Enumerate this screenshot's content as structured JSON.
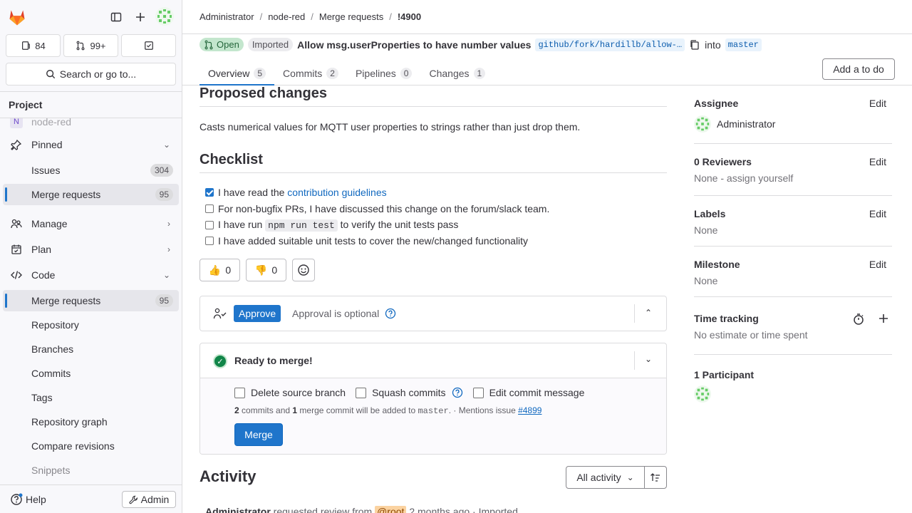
{
  "sidebar": {
    "counts": {
      "issues": "84",
      "merge_requests": "99+"
    },
    "search_label": "Search or go to...",
    "project_header": "Project",
    "project_name": "node-red",
    "pinned_label": "Pinned",
    "pinned_items": [
      {
        "label": "Issues",
        "count": "304"
      },
      {
        "label": "Merge requests",
        "count": "95"
      }
    ],
    "sections": [
      {
        "label": "Manage"
      },
      {
        "label": "Plan"
      },
      {
        "label": "Code"
      }
    ],
    "code_items": [
      {
        "label": "Merge requests",
        "count": "95"
      },
      {
        "label": "Repository"
      },
      {
        "label": "Branches"
      },
      {
        "label": "Commits"
      },
      {
        "label": "Tags"
      },
      {
        "label": "Repository graph"
      },
      {
        "label": "Compare revisions"
      },
      {
        "label": "Snippets"
      }
    ],
    "help_label": "Help",
    "admin_label": "Admin"
  },
  "breadcrumb": [
    "Administrator",
    "node-red",
    "Merge requests",
    "!4900"
  ],
  "mr": {
    "state": "Open",
    "imported": "Imported",
    "title": "Allow msg.userProperties to have number values",
    "source_branch": "github/fork/hardillb/allow-…",
    "into": "into",
    "target_branch": "master"
  },
  "tabs": [
    {
      "label": "Overview",
      "count": "5"
    },
    {
      "label": "Commits",
      "count": "2"
    },
    {
      "label": "Pipelines",
      "count": "0"
    },
    {
      "label": "Changes",
      "count": "1"
    }
  ],
  "todo_label": "Add a to do",
  "description": {
    "heading": "Proposed changes",
    "text": "Casts numerical values for MQTT user properties to strings rather than just drop them.",
    "checklist_heading": "Checklist",
    "checklist": {
      "item1_prefix": "I have read the ",
      "item1_link": "contribution guidelines",
      "item2": "For non-bugfix PRs, I have discussed this change on the forum/slack team.",
      "item3_prefix": "I have run ",
      "item3_code": "npm run test",
      "item3_suffix": " to verify the unit tests pass",
      "item4": "I have added suitable unit tests to cover the new/changed functionality"
    }
  },
  "reactions": {
    "thumbsup": "0",
    "thumbsdown": "0"
  },
  "approval": {
    "button": "Approve",
    "text": "Approval is optional"
  },
  "merge": {
    "status": "Ready to merge!",
    "delete_source": "Delete source branch",
    "squash": "Squash commits",
    "edit_message": "Edit commit message",
    "info_commits": "2",
    "info_commits_text": " commits and ",
    "info_merge": "1",
    "info_merge_text": " merge commit will be added to ",
    "info_branch": "master",
    "info_mention": ". · Mentions issue ",
    "info_issue": "#4899",
    "button": "Merge"
  },
  "activity": {
    "heading": "Activity",
    "filter": "All activity",
    "first_author": "Administrator",
    "first_action": " requested review from ",
    "first_mention": "@root",
    "first_time": " 2 months ago · Imported"
  },
  "right": {
    "assignee_title": "Assignee",
    "assignee_name": "Administrator",
    "reviewers_title": "0 Reviewers",
    "reviewers_value": "None - assign yourself",
    "labels_title": "Labels",
    "labels_value": "None",
    "milestone_title": "Milestone",
    "milestone_value": "None",
    "time_title": "Time tracking",
    "time_value": "No estimate or time spent",
    "participants_title": "1 Participant",
    "edit_label": "Edit"
  },
  "colors": {
    "accent": "#1f75cb",
    "success": "#108548",
    "brand": "#e24329"
  }
}
